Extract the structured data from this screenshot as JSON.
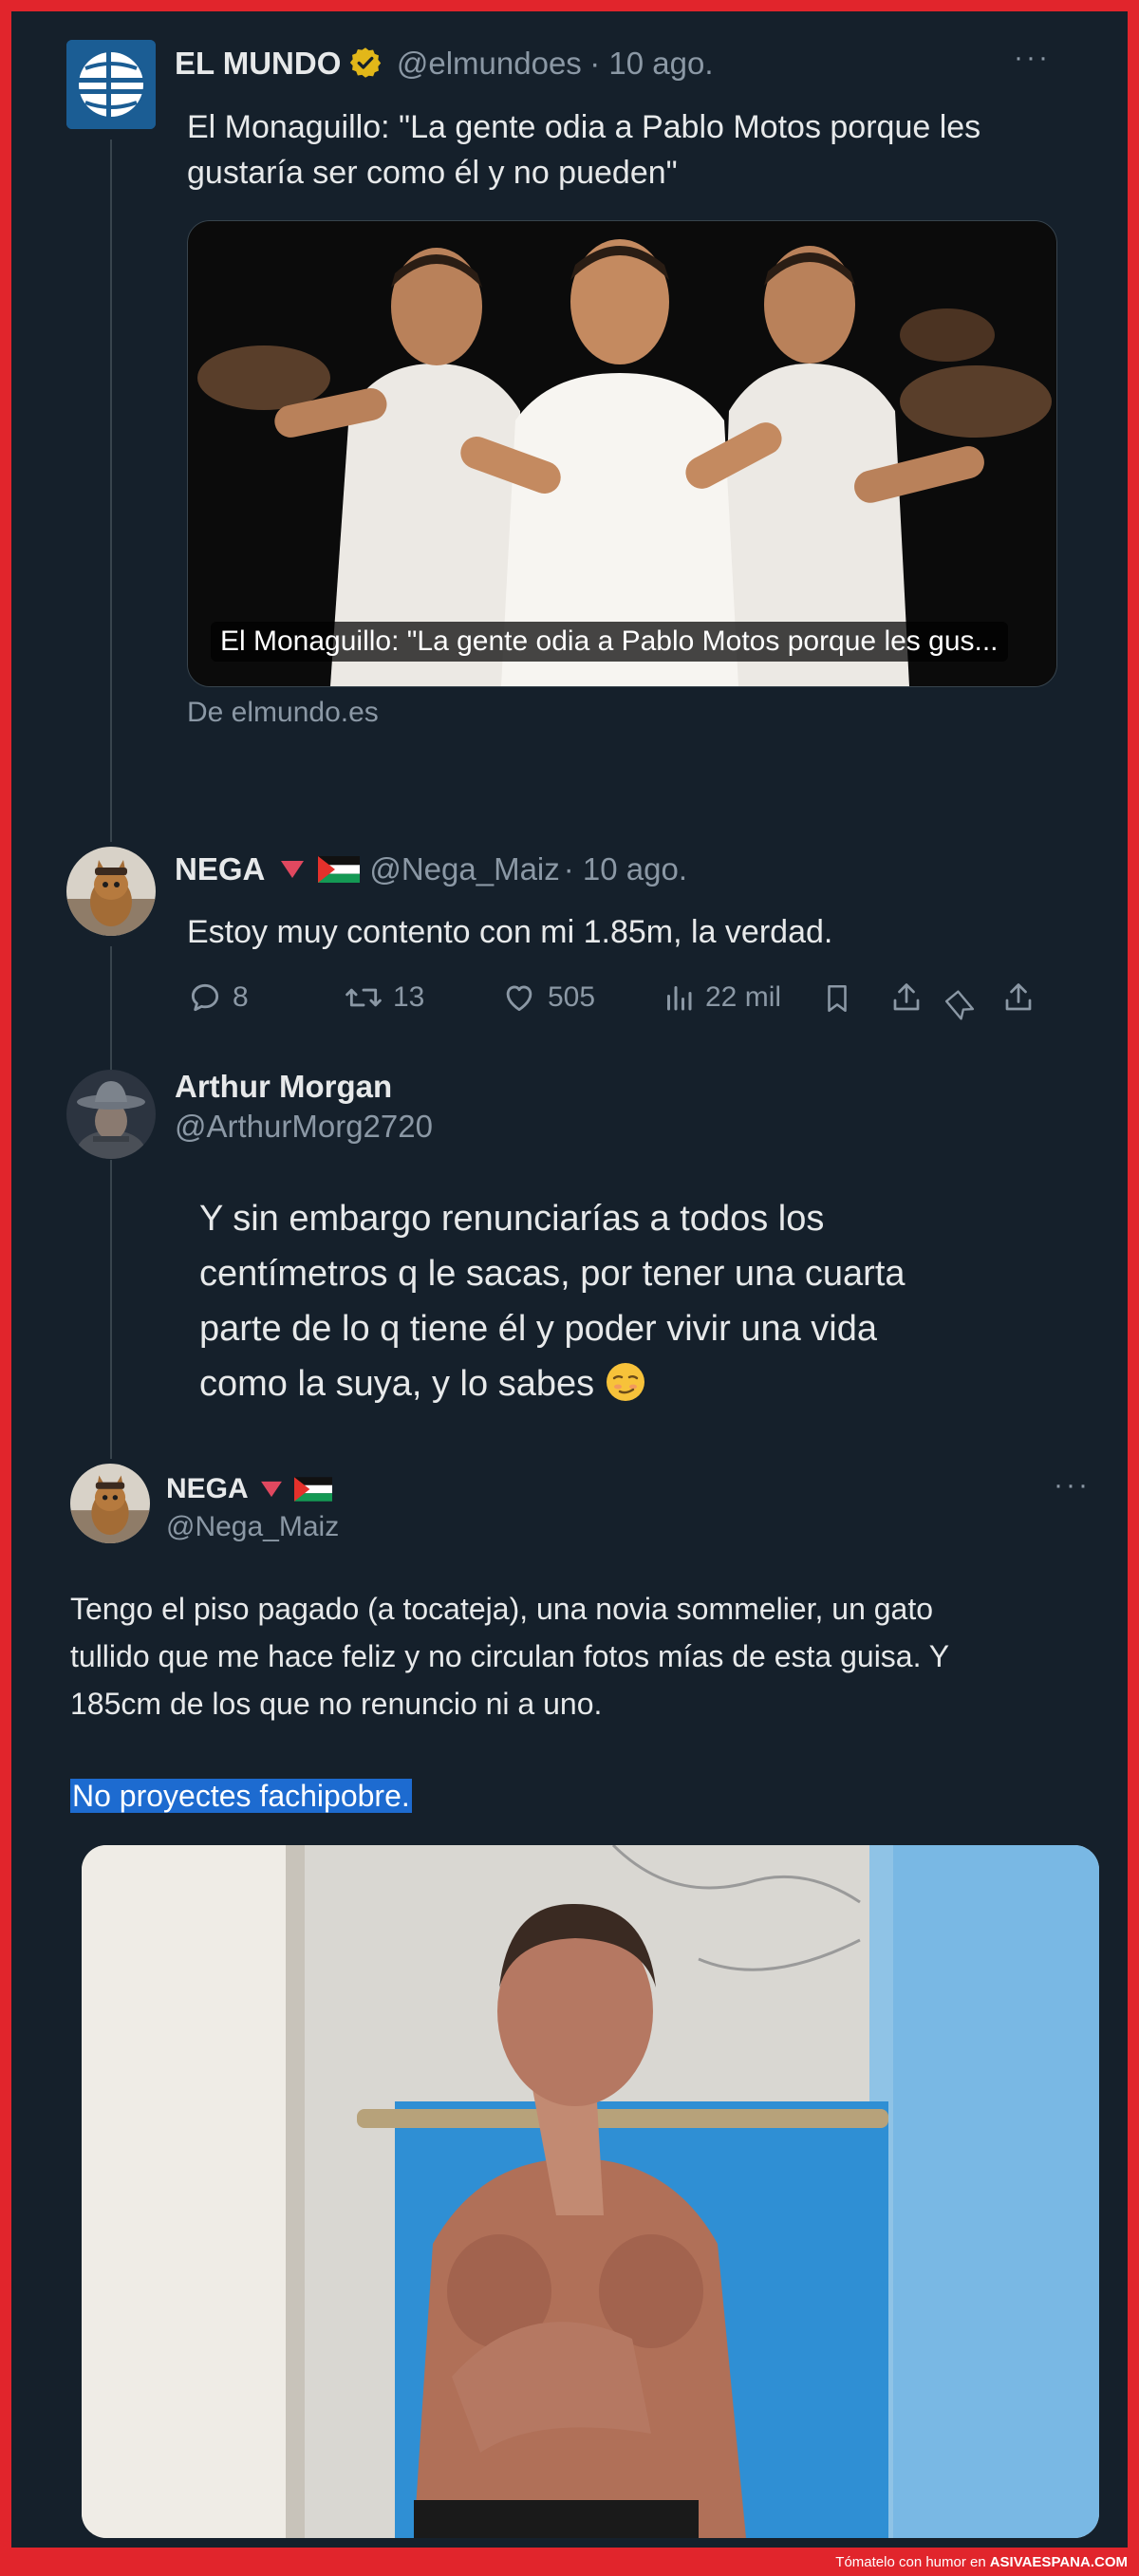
{
  "tweet1": {
    "name": "EL MUNDO",
    "handle": "@elmundoes",
    "date": "· 10 ago.",
    "more": "···",
    "text_line1": "El Monaguillo: \"La gente odia a Pablo Motos porque les",
    "text_line2": "gustaría ser como él y no pueden\"",
    "card_caption": "El Monaguillo: \"La gente odia a Pablo Motos porque les gus...",
    "card_source": "De elmundo.es"
  },
  "tweet2": {
    "name": "NEGA",
    "handle": "@Nega_Maiz",
    "date": "· 10 ago.",
    "text": "Estoy muy contento con mi 1.85m, la verdad.",
    "replies": "8",
    "retweets": "13",
    "likes": "505",
    "views": "22 mil"
  },
  "tweet3": {
    "name": "Arthur Morgan",
    "handle": "@ArthurMorg2720",
    "line1": "Y sin embargo renunciarías a todos los",
    "line2": "centímetros q le sacas, por tener una cuarta",
    "line3": "parte de lo q tiene él y poder vivir una vida",
    "line4": "como la suya, y lo sabes"
  },
  "tweet4": {
    "name": "NEGA",
    "handle": "@Nega_Maiz",
    "more": "···",
    "line1": "Tengo el piso pagado (a tocateja), una novia sommelier, un gato",
    "line2": "tullido que me hace feliz y no circulan fotos mías de esta guisa. Y",
    "line3": "185cm de los que no renuncio ni a uno.",
    "highlighted": "No proyectes fachipobre."
  },
  "footer": {
    "prefix": "Tómatelo con humor en",
    "site": "ASIVAESPANA.COM"
  },
  "colors": {
    "background": "#15202b",
    "border": "#e1252c",
    "text": "#e7e9ea",
    "muted": "#8b98a5",
    "selection": "#1d6bd0",
    "verified": "#e2b719"
  }
}
